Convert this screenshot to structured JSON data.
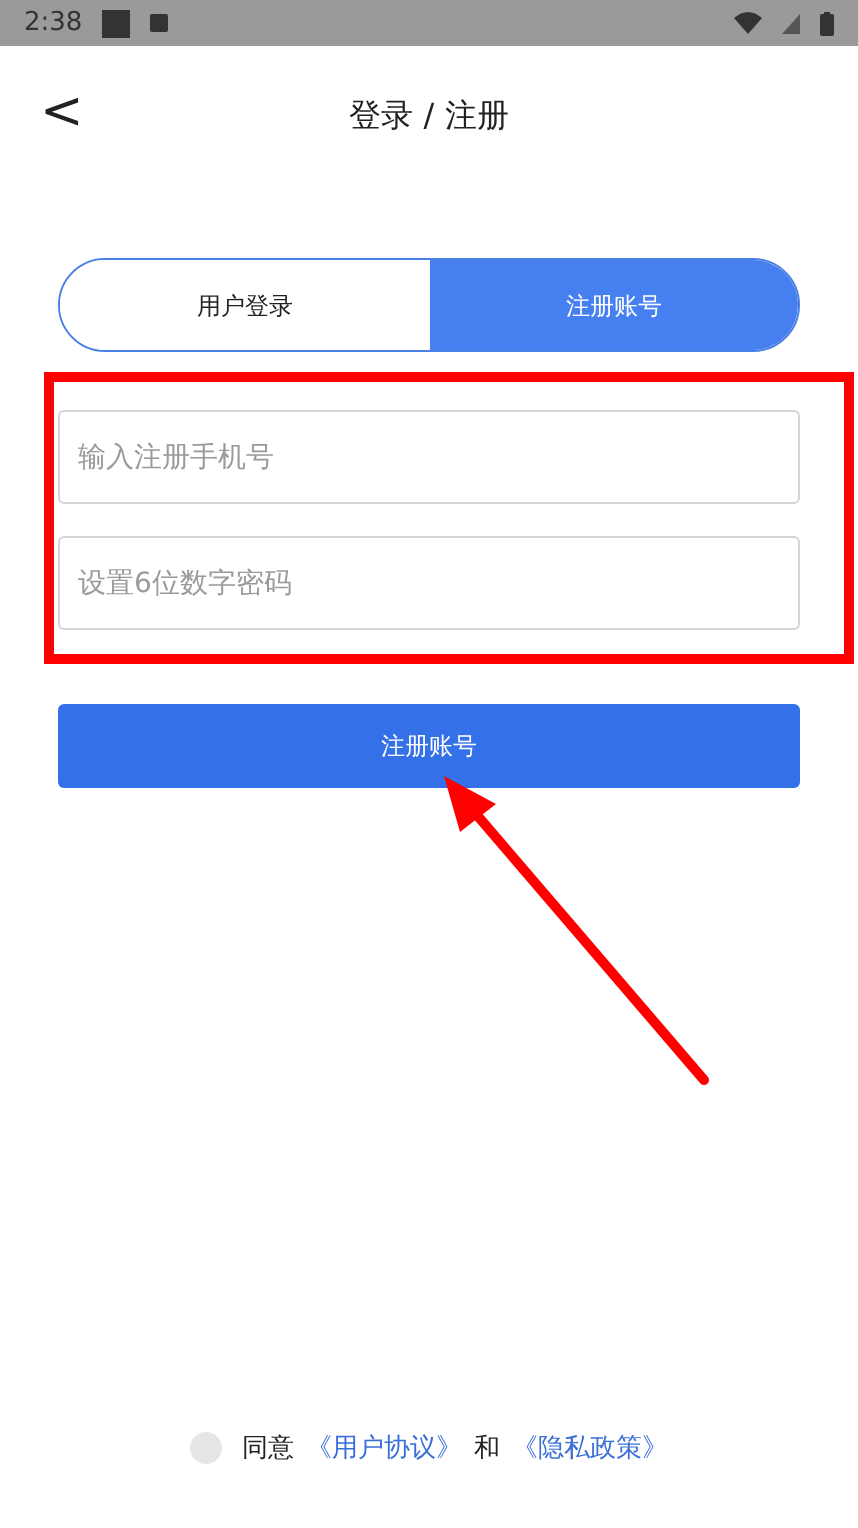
{
  "status_bar": {
    "time": "2:38"
  },
  "header": {
    "back": "<",
    "title": "登录 / 注册"
  },
  "tabs": [
    {
      "label": "用户登录",
      "selected": false
    },
    {
      "label": "注册账号",
      "selected": true
    }
  ],
  "fields": [
    {
      "placeholder": "输入注册手机号"
    },
    {
      "placeholder": "设置6位数字密码"
    }
  ],
  "submit_button": "注册账号",
  "agreement": {
    "checked": false,
    "prefix": "同意",
    "link_1": "《用户协议》",
    "joiner": "和",
    "link_2": "《隐私政策》"
  }
}
